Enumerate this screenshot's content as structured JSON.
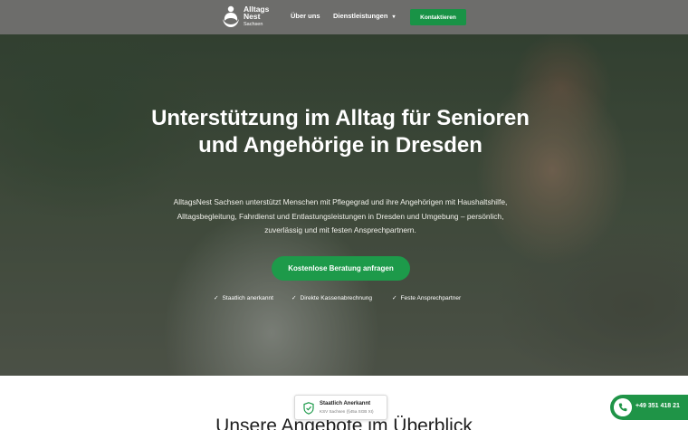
{
  "header": {
    "logo": {
      "line1": "Alltags",
      "line2": "Nest",
      "line3": "Sachsen"
    },
    "nav": {
      "about": "Über uns",
      "services": "Dienstleistungen"
    },
    "contact_button": "Kontaktieren"
  },
  "hero": {
    "title": "Unterstützung im Alltag für Senioren und Angehörige in Dresden",
    "description": "AlltagsNest Sachsen unterstützt Menschen mit Pflegegrad und ihre Angehörigen mit Haushaltshilfe, Alltagsbegleitung, Fahrdienst und Entlastungsleistungen in Dresden und Umgebung – persönlich, zuverlässig und mit festen Ansprechpartnern.",
    "cta": "Kostenlose Beratung anfragen",
    "features": [
      "Staatlich anerkannt",
      "Direkte Kassenabrechnung",
      "Feste Ansprechpartner"
    ]
  },
  "badge": {
    "title": "Staatlich Anerkannt",
    "subtitle": "KSV Sachsen (§45a SGB XI)"
  },
  "section": {
    "title": "Unsere Angebote im Überblick"
  },
  "phone": {
    "number": "+49 351 418 21"
  },
  "colors": {
    "accent": "#1d9a4a",
    "header_bg": "#6d6d6b"
  },
  "icons": {
    "logo": "hands-heart-icon",
    "chevron": "chevron-down-icon",
    "check": "check-icon",
    "shield": "shield-check-icon",
    "phone": "phone-icon"
  }
}
